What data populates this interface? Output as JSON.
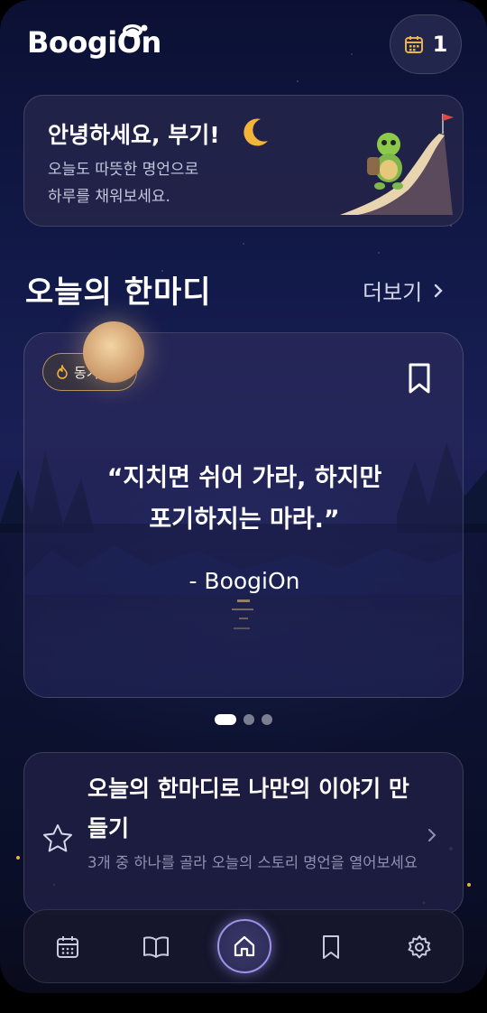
{
  "header": {
    "logo": "BoogiOn",
    "calendar_count": "1"
  },
  "greeting": {
    "title": "안녕하세요, 부기!",
    "line1": "오늘도 따뜻한 명언으로",
    "line2": "하루를 채워보세요."
  },
  "section": {
    "title": "오늘의 한마디",
    "more": "더보기"
  },
  "quote": {
    "tag": "동기부여",
    "line1": "“지치면 쉬어 가라, 하지만",
    "line2": "포기하지는 마라.”",
    "author": "- BoogiOn",
    "page_index": 1,
    "page_count": 3
  },
  "story": {
    "title": "오늘의 한마디로 나만의 이야기 만들기",
    "subtitle": "3개 중 하나를 골라 오늘의 스토리 명언을 열어보세요"
  },
  "nav": {
    "items": [
      "calendar-icon",
      "book-icon",
      "home-icon",
      "bookmark-icon",
      "gear-icon"
    ],
    "active": "home-icon"
  },
  "colors": {
    "accent": "#9d94e8",
    "tag_border": "#e6be6e",
    "background_top": "#0b1033"
  }
}
